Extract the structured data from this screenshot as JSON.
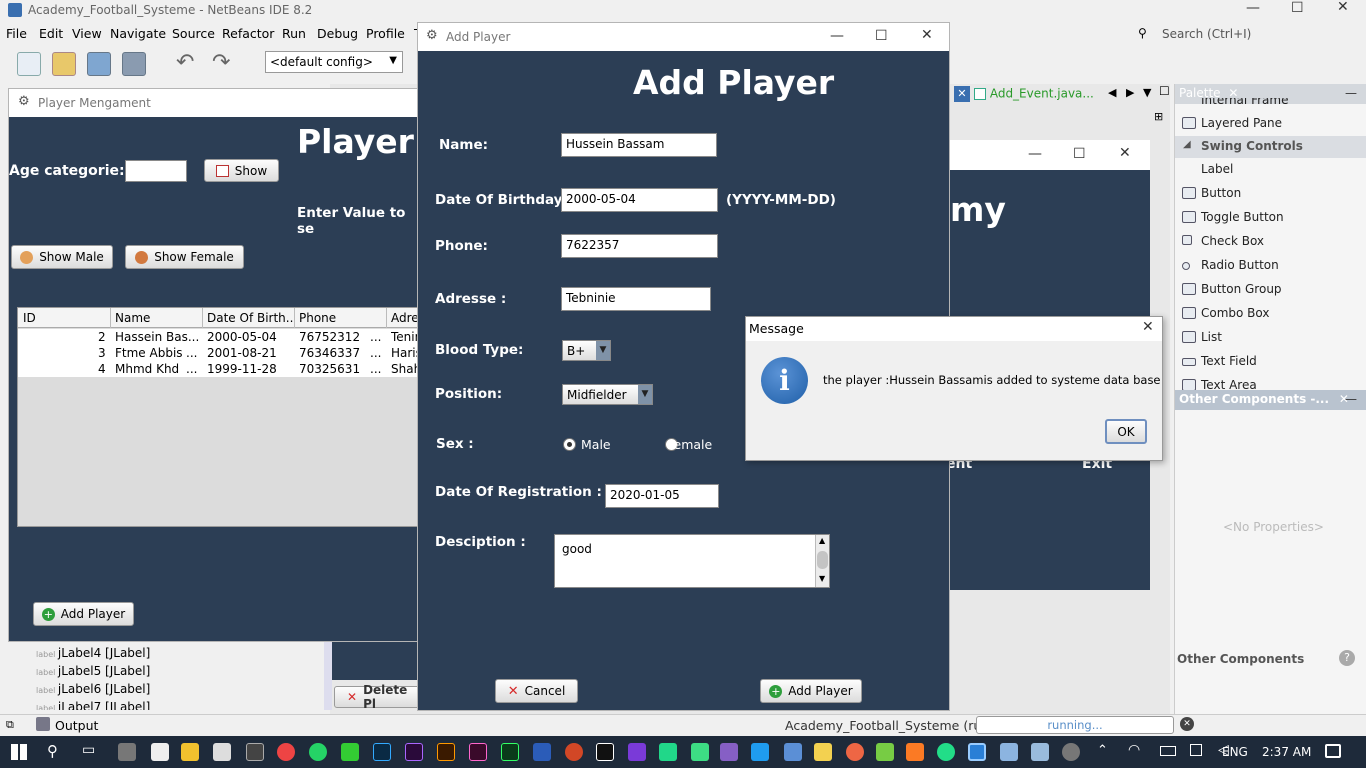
{
  "ide": {
    "title": "Academy_Football_Systeme - NetBeans IDE 8.2",
    "menu": [
      "File",
      "Edit",
      "View",
      "Navigate",
      "Source",
      "Refactor",
      "Run",
      "Debug",
      "Profile",
      "T"
    ],
    "config": "<default config>",
    "search_placeholder": "Search (Ctrl+I)",
    "editor_tab": "Add_Event.java...",
    "palette_title": "Palette",
    "palette_items": [
      {
        "label": "Layered Pane",
        "icon": "layered-pane-icon"
      },
      {
        "label": "Label",
        "icon": "label-icon"
      },
      {
        "label": "Button",
        "icon": "button-icon"
      },
      {
        "label": "Toggle Button",
        "icon": "toggle-button-icon"
      },
      {
        "label": "Check Box",
        "icon": "check-box-icon"
      },
      {
        "label": "Radio Button",
        "icon": "radio-button-icon"
      },
      {
        "label": "Button Group",
        "icon": "button-group-icon"
      },
      {
        "label": "Combo Box",
        "icon": "combo-box-icon"
      },
      {
        "label": "List",
        "icon": "list-icon"
      },
      {
        "label": "Text Field",
        "icon": "text-field-icon"
      },
      {
        "label": "Text Area",
        "icon": "text-area-icon"
      }
    ],
    "palette_section": "Swing Controls",
    "palette_partial_top": "Internal Frame",
    "other_components_tab": "Other Components -...",
    "no_properties": "<No Properties>",
    "other_components_footer": "Other Components",
    "navigator_items": [
      "jLabel4 [JLabel]",
      "jLabel5 [JLabel]",
      "jLabel6 [JLabel]",
      "jLabel7 [JLabel]"
    ],
    "delete_button_partial": "Delete Pl",
    "output_label": "Output",
    "status_project": "Academy_Football_Systeme (run)",
    "status_progress": "running...",
    "bg_frame_title_partial": "my",
    "bg_frame_labels": [
      "ent",
      "Exit"
    ]
  },
  "player_mgmt": {
    "window_title": "Player Mengament",
    "heading_partial": "Player",
    "age_label": "Age categorie:",
    "show_button": "Show",
    "enter_value_partial": "Enter Value to se",
    "show_male": "Show Male",
    "show_female": "Show Female",
    "columns": [
      "ID",
      "Name",
      "Date Of Birth...",
      "Phone",
      "Adres"
    ],
    "rows": [
      {
        "id": "2",
        "name": "Hassein Bas...",
        "dob": "2000-05-04",
        "phone": "76752312",
        "ellipsis": "...",
        "addr": "Tenin"
      },
      {
        "id": "3",
        "name": "Ftme Abbis",
        "name_ellipsis": "...",
        "dob": "2001-08-21",
        "phone": "76346337",
        "ellipsis": "...",
        "addr": "Haris"
      },
      {
        "id": "4",
        "name": "Mhmd Khd",
        "name_ellipsis": "...",
        "dob": "1999-11-28",
        "phone": "70325631",
        "ellipsis": "...",
        "addr": "Shah"
      }
    ],
    "add_player_button": "Add Player"
  },
  "add_player": {
    "window_title": "Add Player",
    "heading": "Add Player",
    "name_label": "Name:",
    "name_value": "Hussein Bassam",
    "dob_label": "Date Of Birthday:",
    "dob_value": "2000-05-04",
    "dob_hint": "(YYYY-MM-DD)",
    "phone_label": "Phone:",
    "phone_value": "7622357",
    "address_label": "Adresse :",
    "address_value": "Tebninie",
    "blood_label": "Blood Type:",
    "blood_value": "B+",
    "position_label": "Position:",
    "position_value": "Midfielder",
    "sex_label": "Sex :",
    "sex_male": "Male",
    "sex_female": "Female",
    "sex_selected": "Male",
    "reg_label": "Date Of Registration :",
    "reg_value": "2020-01-05",
    "desc_label": "Desciption :",
    "desc_value": "good",
    "cancel_button": "Cancel",
    "add_button": "Add Player"
  },
  "message": {
    "title": "Message",
    "text": "the player :Hussein Bassamis added to systeme data base",
    "ok": "OK"
  },
  "taskbar": {
    "language": "ENG",
    "time": "2:37 AM"
  },
  "colors": {
    "navy": "#2c3e55",
    "info_blue": "#1f5fa8",
    "green_add": "#2e9e3c",
    "red_cancel": "#d62a2a"
  }
}
